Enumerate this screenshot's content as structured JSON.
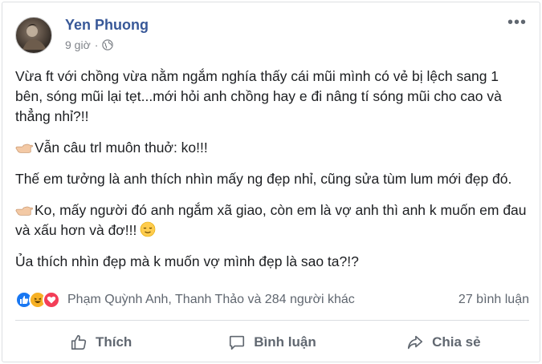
{
  "post": {
    "author": "Yen Phuong",
    "time": "9 giờ",
    "privacy_icon": "globe-icon",
    "more_icon": "more-options-icon",
    "paragraphs": [
      {
        "icon": "",
        "text": "Vừa ft với chồng vừa nằm ngắm nghía thấy cái mũi mình có vẻ bị lệch sang 1 bên, sóng mũi lại tẹt...mới hỏi anh chồng hay e đi nâng tí sóng mũi cho cao và thẳng nhỉ?!!",
        "emoji": ""
      },
      {
        "icon": "pointing-hand-icon",
        "text": "Vẫn câu trl muôn thuở: ko!!!",
        "emoji": ""
      },
      {
        "icon": "",
        "text": "Thế em tưởng là anh thích nhìn mấy ng đẹp nhỉ, cũng sửa tùm lum mới đẹp đó.",
        "emoji": ""
      },
      {
        "icon": "pointing-hand-icon",
        "text": "Ko, mấy người đó anh ngắm xã giao, còn em là vợ anh thì anh k muốn em đau và xấu hơn và đơ!!!",
        "emoji": "relieved-face-icon"
      },
      {
        "icon": "",
        "text": "Ủa thích nhìn đẹp mà k muốn vợ mình đẹp là sao ta?!?",
        "emoji": ""
      }
    ]
  },
  "reactions": {
    "icons": [
      "like-reaction-icon",
      "haha-reaction-icon",
      "love-reaction-icon"
    ],
    "names": "Phạm Quỳnh Anh, Thanh Thảo và 284 người khác",
    "comments": "27 bình luận"
  },
  "actions": {
    "like": "Thích",
    "comment": "Bình luận",
    "share": "Chia sẻ"
  },
  "colors": {
    "author": "#385898",
    "like_reaction": "#1877f2",
    "haha_reaction": "#f7b125",
    "love_reaction": "#f33e58"
  }
}
